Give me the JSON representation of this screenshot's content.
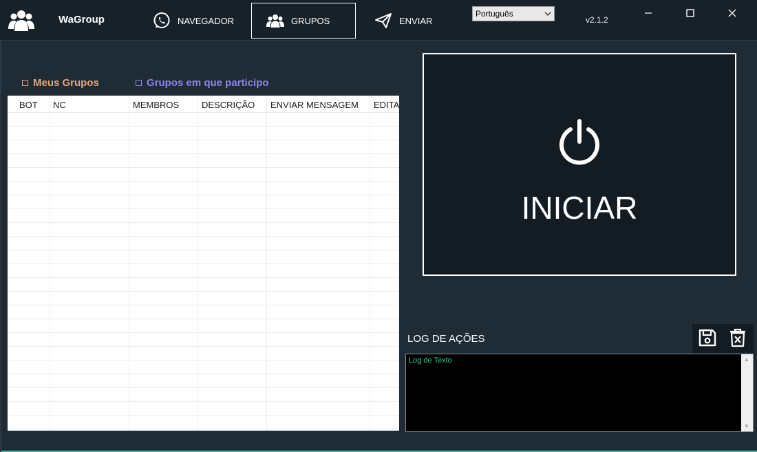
{
  "app": {
    "title": "WaGroup",
    "version": "v2.1.2"
  },
  "nav": [
    {
      "label": "NAVEGADOR",
      "icon": "whatsapp-icon"
    },
    {
      "label": "GRUPOS",
      "icon": "users-icon",
      "active": true
    },
    {
      "label": "ENVIAR",
      "icon": "send-icon"
    }
  ],
  "language": {
    "selected": "Português"
  },
  "tabs": {
    "meus": "Meus Grupos",
    "participo": "Grupos em que participo"
  },
  "grid": {
    "columns": [
      "BOT",
      "NC",
      "MEMBROS",
      "DESCRIÇÃO",
      "ENVIAR MENSAGEM",
      "EDITA"
    ]
  },
  "start": {
    "label": "INICIAR",
    "icon": "power-icon"
  },
  "log": {
    "title": "LOG DE AÇÕES",
    "text": "Log de Texto"
  },
  "colors": {
    "background": "#16212a",
    "panel": "#1f2c35",
    "meus": "#e6a57b",
    "participo": "#8b86e8",
    "log_text": "#2fd08a",
    "accent_line": "#2ec4a8"
  }
}
